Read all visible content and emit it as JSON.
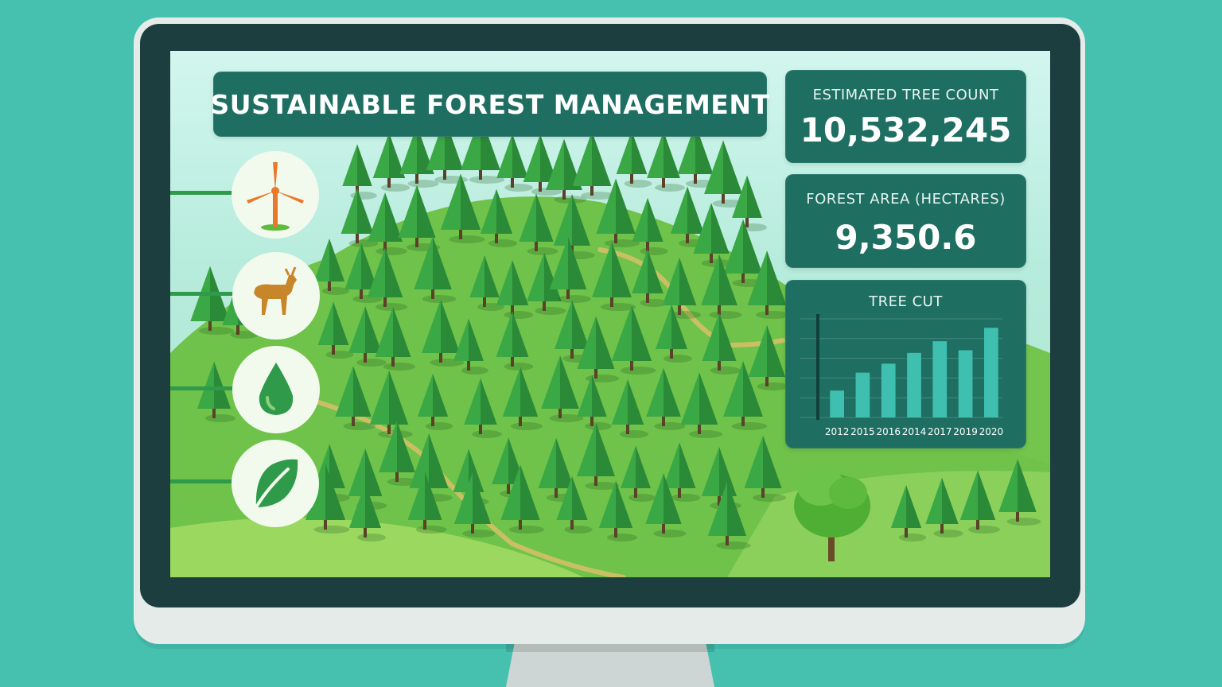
{
  "dashboard": {
    "title": "SUSTAINABLE FOREST MANAGEMENT",
    "tree_count": {
      "label": "ESTIMATED TREE COUNT",
      "value": "10,532,245"
    },
    "forest_area": {
      "label": "FOREST AREA (HECTARES)",
      "value": "9,350.6"
    }
  },
  "sidebar_icons": [
    "wind-turbine-icon",
    "deer-icon",
    "water-drop-icon",
    "leaf-icon"
  ],
  "colors": {
    "background": "#46c1b0",
    "panel": "#1e6e62",
    "bar": "#3fbfb0",
    "hill": "#6cc04a",
    "tree": "#2f9a3e"
  },
  "chart_data": {
    "type": "bar",
    "title": "TREE CUT",
    "categories": [
      "2012",
      "2015",
      "2016",
      "2014",
      "2017",
      "2019",
      "2020"
    ],
    "values": [
      3,
      5,
      6,
      7.2,
      8.5,
      7.5,
      10
    ],
    "ylim": [
      0,
      11
    ],
    "grid": true,
    "xlabel": "",
    "ylabel": ""
  }
}
